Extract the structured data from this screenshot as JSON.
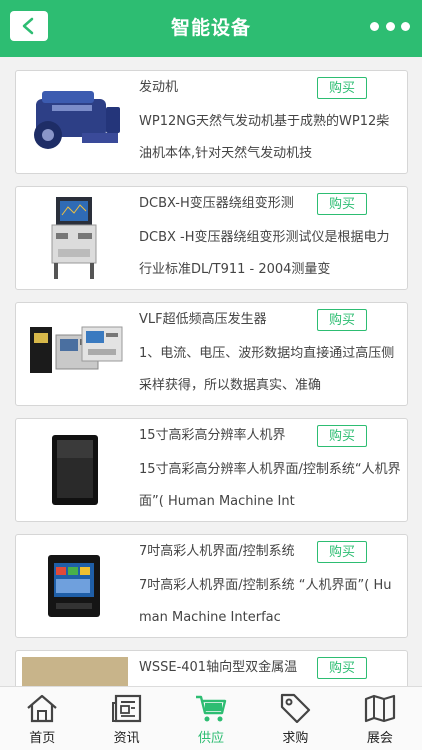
{
  "header": {
    "title": "智能设备",
    "back_icon": "chevron-left-icon",
    "more_icon": "more-dots-icon",
    "bg_color": "#2dbd72"
  },
  "products": [
    {
      "name": "发动机",
      "buy_label": "购买",
      "desc": "WP12NG天然气发动机基于成熟的WP12柴油机本体,针对天然气发动机技"
    },
    {
      "name": "DCBX-H变压器绕组变形测",
      "buy_label": "购买",
      "desc": "DCBX -H变压器绕组变形测试仪是根据电力行业标准DL/T911 - 2004测量变"
    },
    {
      "name": "VLF超低频高压发生器",
      "buy_label": "购买",
      "desc": "1、电流、电压、波形数据均直接通过高压侧采样获得，所以数据真实、准确"
    },
    {
      "name": "15寸高彩高分辨率人机界",
      "buy_label": "购买",
      "desc": "15寸高彩高分辨率人机界面/控制系统“人机界面”( Human Machine Int"
    },
    {
      "name": "7吋高彩人机界面/控制系统",
      "buy_label": "购买",
      "desc": "7吋高彩人机界面/控制系统 “人机界面”( Human Machine Interfac"
    },
    {
      "name": "WSSE-401轴向型双金属温",
      "buy_label": "购买",
      "desc": ""
    }
  ],
  "tabbar": {
    "items": [
      {
        "label": "首页",
        "icon": "home-icon"
      },
      {
        "label": "资讯",
        "icon": "news-icon"
      },
      {
        "label": "供应",
        "icon": "cart-icon",
        "active": true
      },
      {
        "label": "求购",
        "icon": "tag-icon"
      },
      {
        "label": "展会",
        "icon": "map-icon"
      }
    ],
    "active_color": "#2dbd72"
  }
}
